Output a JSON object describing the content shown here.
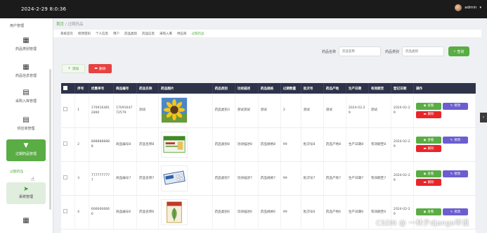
{
  "topbar": {
    "datetime": "2024-2-29 8:0:36",
    "username": "admin",
    "caret": "▾"
  },
  "sidebar": {
    "top_label": "用户管理",
    "items": [
      {
        "label": "药品类别管理",
        "icon": "grid-icon"
      },
      {
        "label": "药品信息管理",
        "icon": "grid-icon"
      },
      {
        "label": "采购入库管理",
        "icon": "clipboard-icon"
      },
      {
        "label": "供应商管理",
        "icon": "clipboard-icon"
      }
    ],
    "active": {
      "label": "过期药品管理",
      "icon": "download-box-icon"
    },
    "sub_item": "过期药品",
    "system": {
      "label": "系统管理",
      "icon": "paper-plane-icon"
    }
  },
  "breadcrumb": {
    "home": "首页",
    "sep": " / ",
    "current": "过期药品"
  },
  "navrow": [
    "系统首页",
    "修改密码",
    "个人信息",
    "用户",
    "药品类别",
    "药品信息",
    "采购入库",
    "供应商",
    "过期药品"
  ],
  "search": {
    "name_label": "药品名称",
    "name_placeholder": "药品名称",
    "cat_label": "药品类别",
    "cat_placeholder": "药品类别",
    "button": "查询"
  },
  "actions": {
    "add": "添加",
    "delete": "删除"
  },
  "table": {
    "headers": [
      "",
      "序号",
      "优惠单号",
      "商品编号",
      "药品名称",
      "药品图片",
      "药品类别",
      "功效描述",
      "药品规格",
      "过期数量",
      "批次号",
      "药品产地",
      "生产日期",
      "有效期至",
      "登记日期",
      "操作"
    ],
    "rows": [
      {
        "index": "1",
        "order": "1709164812890",
        "code": "1709164772579",
        "name": "测试",
        "image": "sunflower",
        "category": "药品类别3",
        "effect": "测试测试",
        "spec": "测试",
        "qty": "3",
        "batch": "测试",
        "origin": "测试",
        "prod_date": "2024-02-29",
        "expiry": "测试",
        "reg_date": "2024-02-29"
      },
      {
        "index": "2",
        "order": "8888888888",
        "code": "商品编号8",
        "name": "药品名称8",
        "image": "medicine-box-green",
        "category": "药品类别8",
        "effect": "功效描述8",
        "spec": "药品规格8",
        "qty": "99",
        "batch": "批次号8",
        "origin": "药品产地8",
        "prod_date": "生产日期8",
        "expiry": "有效期至8",
        "reg_date": "2024-02-29"
      },
      {
        "index": "3",
        "order": "7777777777",
        "code": "商品编号7",
        "name": "药品名称7",
        "image": "blister-pack",
        "category": "药品类别7",
        "effect": "功效描述7",
        "spec": "药品规格7",
        "qty": "99",
        "batch": "批次号7",
        "origin": "药品产地7",
        "prod_date": "生产日期7",
        "expiry": "有效期至7",
        "reg_date": "2024-02-29"
      },
      {
        "index": "4",
        "order": "6666666666",
        "code": "商品编号6",
        "name": "药品名称6",
        "image": "medicine-box-herbal",
        "category": "药品类别6",
        "effect": "功效描述6",
        "spec": "药品规格6",
        "qty": "99",
        "batch": "批次号6",
        "origin": "药品产地6",
        "prod_date": "生产日期6",
        "expiry": "有效期至6",
        "reg_date": "2024-02-29"
      }
    ],
    "ops": {
      "view": "查看",
      "edit": "修改",
      "delete": "删除"
    }
  },
  "watermark": "CSDN @ 一林夕django毕设",
  "colors": {
    "accent": "#5aac44",
    "danger": "#e84141",
    "edit": "#6b5fd0",
    "header": "#2e3349",
    "topbar": "#1b1b1b"
  }
}
